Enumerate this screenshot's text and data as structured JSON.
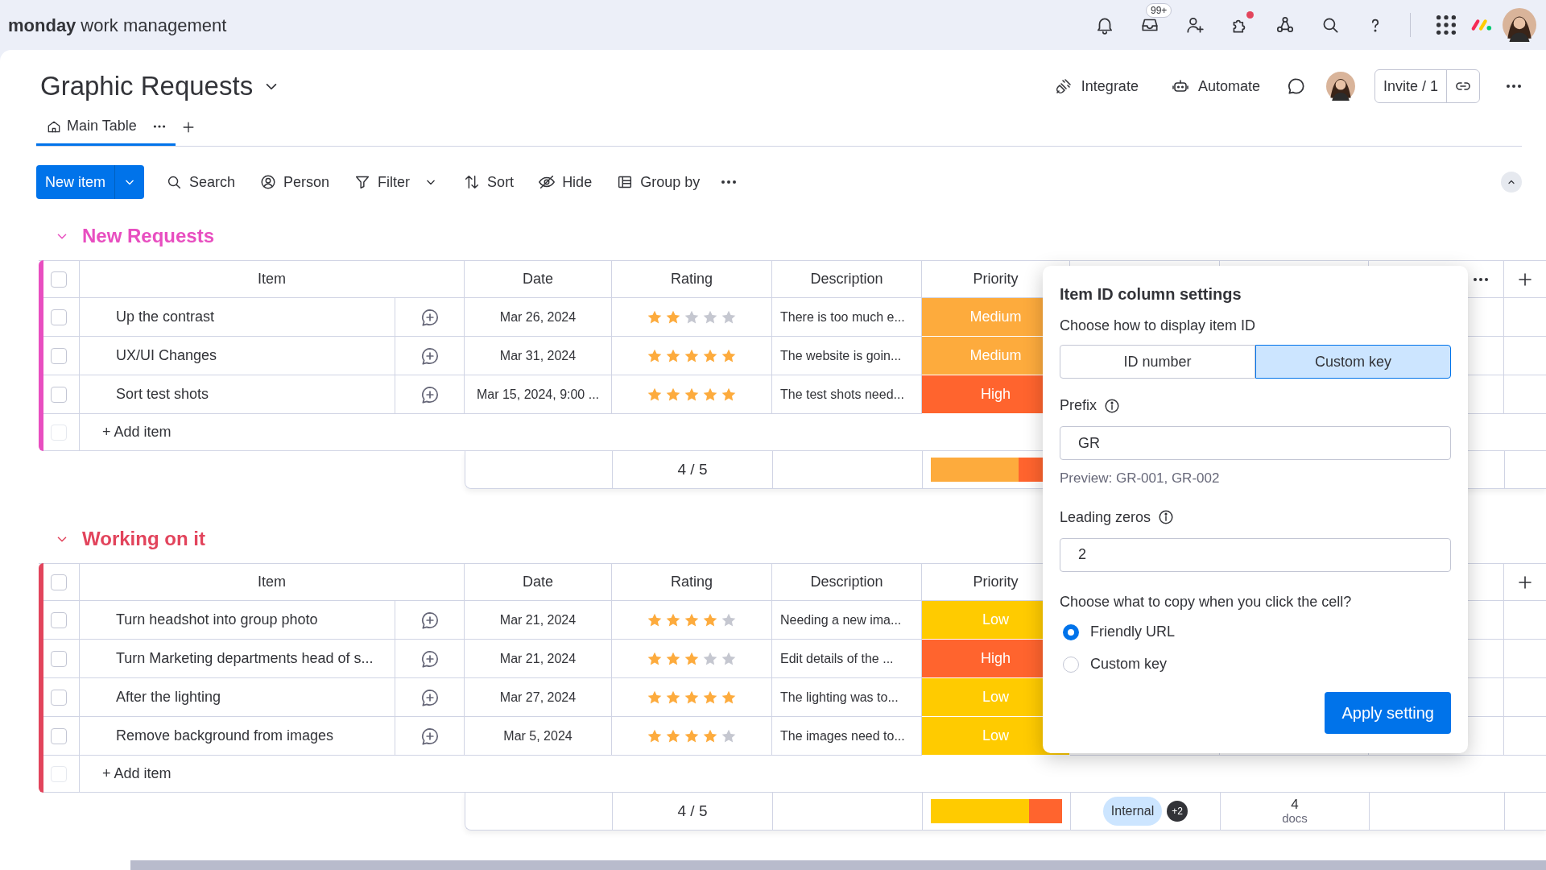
{
  "app": {
    "brand": "monday",
    "product": "work management",
    "inbox_badge": "99+",
    "notification_dot": true
  },
  "board": {
    "title": "Graphic Requests",
    "actions": [
      "Integrate",
      "Automate"
    ],
    "invite": "Invite / 1"
  },
  "views": [
    {
      "label": "Main Table",
      "selected": true
    }
  ],
  "toolbar": {
    "new_item": "New item",
    "tools": [
      "Search",
      "Person",
      "Filter",
      "Sort",
      "Hide",
      "Group by"
    ]
  },
  "groups": [
    {
      "title": "New Requests",
      "color": "#e84ec0",
      "header_menu": true,
      "all_checked": false,
      "add_row_checked": false,
      "columns": [
        "Item",
        "Date",
        "Rating",
        "Description",
        "Priority"
      ],
      "add_item": "+ Add item",
      "rows": [
        {
          "checked": false,
          "item": "Up the contrast",
          "date": "Mar 26, 2024",
          "stars": 2,
          "description": "There is too much e...",
          "priority": "Medium",
          "color": "#fdab3d"
        },
        {
          "checked": false,
          "item": "UX/UI Changes",
          "date": "Mar 31, 2024",
          "stars": 5,
          "description": "The website is goin...",
          "priority": "Medium",
          "color": "#fdab3d"
        },
        {
          "checked": false,
          "item": "Sort test shots",
          "date": "Mar 15, 2024, 9:00 ...",
          "stars": 5,
          "description": "The test shots need...",
          "priority": "High",
          "color": "#ff642e"
        }
      ],
      "summary": {
        "rating": "4 / 5",
        "priority_bar": [
          {
            "color": "#fdab3d",
            "level": 0.67
          },
          {
            "color": "#ff642e",
            "level": 0.33
          }
        ]
      }
    },
    {
      "title": "Working on it",
      "color": "#e2445c",
      "header_menu": false,
      "all_checked": false,
      "add_row_checked": false,
      "columns": [
        "Item",
        "Date",
        "Rating",
        "Description",
        "Priority"
      ],
      "add_item": "+ Add item",
      "rows": [
        {
          "checked": false,
          "item": "Turn headshot into group photo",
          "date": "Mar 21, 2024",
          "stars": 4,
          "description": "Needing a new ima...",
          "priority": "Low",
          "color": "#ffcb00"
        },
        {
          "checked": false,
          "item": "Turn Marketing departments head of s...",
          "date": "Mar 21, 2024",
          "stars": 3,
          "description": "Edit details of the ...",
          "priority": "High",
          "color": "#ff642e"
        },
        {
          "checked": false,
          "item": "After the lighting",
          "date": "Mar 27, 2024",
          "stars": 5,
          "description": "The lighting was to...",
          "priority": "Low",
          "color": "#ffcb00"
        },
        {
          "checked": false,
          "item": "Remove background from images",
          "date": "Mar 5, 2024",
          "stars": 4,
          "description": "The images need to...",
          "priority": "Low",
          "color": "#ffcb00"
        }
      ],
      "summary": {
        "rating": "4 / 5",
        "priority_bar": [
          {
            "color": "#ffcb00",
            "level": 0.75
          },
          {
            "color": "#ff642e",
            "level": 0.25
          }
        ],
        "tag": "Internal",
        "tag_more": "+2",
        "docs_count": "4",
        "docs_label": "docs"
      }
    }
  ],
  "settings_popup": {
    "title": "Item ID column settings",
    "display_label": "Choose how to display item ID",
    "display_options": [
      {
        "label": "ID number",
        "selected": false
      },
      {
        "label": "Custom key",
        "selected": true
      }
    ],
    "prefix_label": "Prefix",
    "prefix_value": "GR",
    "preview": "Preview: GR-001, GR-002",
    "zeros_label": "Leading zeros",
    "zeros_value": "2",
    "copy_label": "Choose what to copy when you click the cell?",
    "copy_options": [
      {
        "label": "Friendly URL",
        "selected": true
      },
      {
        "label": "Custom key",
        "selected": false
      }
    ],
    "apply": "Apply setting"
  }
}
